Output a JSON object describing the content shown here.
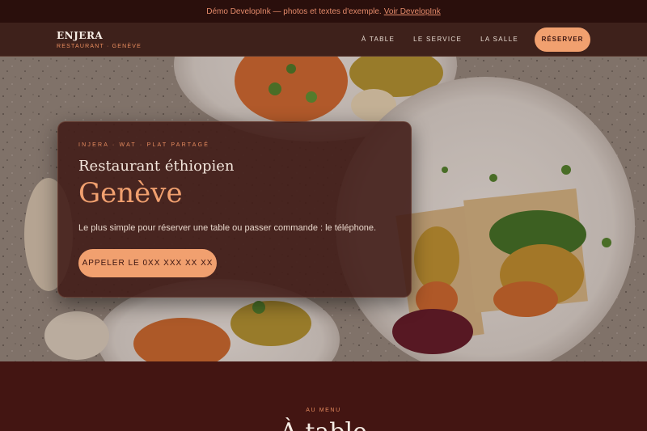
{
  "banner": {
    "text": "Démo DevelopInk — photos et textes d'exemple.",
    "link": "Voir DevelopInk"
  },
  "nav": {
    "brand": "ENJERA",
    "tagline": "RESTAURANT · GENÈVE",
    "links": [
      "À TABLE",
      "LE SERVICE",
      "LA SALLE"
    ],
    "reserve": "RÉSERVER"
  },
  "hero": {
    "eyebrow": "INJERA · WAT · PLAT PARTAGÉ",
    "title": "Restaurant éthiopien",
    "city": "Genève",
    "text": "Le plus simple pour réserver une table ou passer commande : le téléphone.",
    "cta": "APPELER LE 0XX XXX XX XX"
  },
  "menu": {
    "eyebrow": "AU MENU",
    "title": "À table"
  },
  "colors": {
    "accent": "#f1a06f",
    "dark": "#3a1410",
    "banner": "#2a0f0c"
  }
}
